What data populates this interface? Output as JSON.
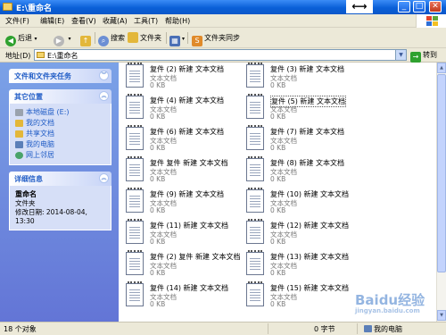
{
  "window": {
    "title": "E:\\重命名"
  },
  "menu": [
    "文件(F)",
    "编辑(E)",
    "查看(V)",
    "收藏(A)",
    "工具(T)",
    "帮助(H)"
  ],
  "toolbar": {
    "back": "后退",
    "search": "搜索",
    "folders": "文件夹",
    "sync": "文件夹同步"
  },
  "address": {
    "label": "地址(D)",
    "value": "E:\\重命名",
    "go": "转到"
  },
  "sidebar": {
    "tasks_title": "文件和文件夹任务",
    "places_title": "其它位置",
    "places": [
      "本地磁盘 (E:)",
      "我的文档",
      "共享文档",
      "我的电脑",
      "网上邻居"
    ],
    "details_title": "详细信息",
    "details_name": "重命名",
    "details_type": "文件夹",
    "details_modified": "修改日期: 2014-08-04, 13:30"
  },
  "files": [
    {
      "name": "复件 (2) 新建 文本文档",
      "type": "文本文档",
      "size": "0 KB"
    },
    {
      "name": "复件 (3) 新建 文本文档",
      "type": "文本文档",
      "size": "0 KB"
    },
    {
      "name": "复件 (4) 新建 文本文档",
      "type": "文本文档",
      "size": "0 KB"
    },
    {
      "name": "复件 (5) 新建 文本文档",
      "type": "文本文档",
      "size": "0 KB"
    },
    {
      "name": "复件 (6) 新建 文本文档",
      "type": "文本文档",
      "size": "0 KB"
    },
    {
      "name": "复件 (7) 新建 文本文档",
      "type": "文本文档",
      "size": "0 KB"
    },
    {
      "name": "复件 复件 新建 文本文档",
      "type": "文本文档",
      "size": "0 KB"
    },
    {
      "name": "复件 (8) 新建 文本文档",
      "type": "文本文档",
      "size": "0 KB"
    },
    {
      "name": "复件 (9) 新建 文本文档",
      "type": "文本文档",
      "size": "0 KB"
    },
    {
      "name": "复件 (10) 新建 文本文档",
      "type": "文本文档",
      "size": "0 KB"
    },
    {
      "name": "复件 (11) 新建 文本文档",
      "type": "文本文档",
      "size": "0 KB"
    },
    {
      "name": "复件 (12) 新建 文本文档",
      "type": "文本文档",
      "size": "0 KB"
    },
    {
      "name": "复件 (2) 复件 新建 文本文档",
      "type": "文本文档",
      "size": "0 KB"
    },
    {
      "name": "复件 (13) 新建 文本文档",
      "type": "文本文档",
      "size": "0 KB"
    },
    {
      "name": "复件 (14) 新建 文本文档",
      "type": "文本文档",
      "size": "0 KB"
    },
    {
      "name": "复件 (15) 新建 文本文档",
      "type": "文本文档",
      "size": "0 KB"
    }
  ],
  "status": {
    "count": "18 个对象",
    "size": "0 字节",
    "location": "我的电脑"
  },
  "watermark": {
    "main": "Baidu经验",
    "sub": "jingyan.baidu.com"
  },
  "colors": {
    "title_blue": "#0a5fd8",
    "sidebar_blue": "#6375d6",
    "link_blue": "#215dc6"
  }
}
